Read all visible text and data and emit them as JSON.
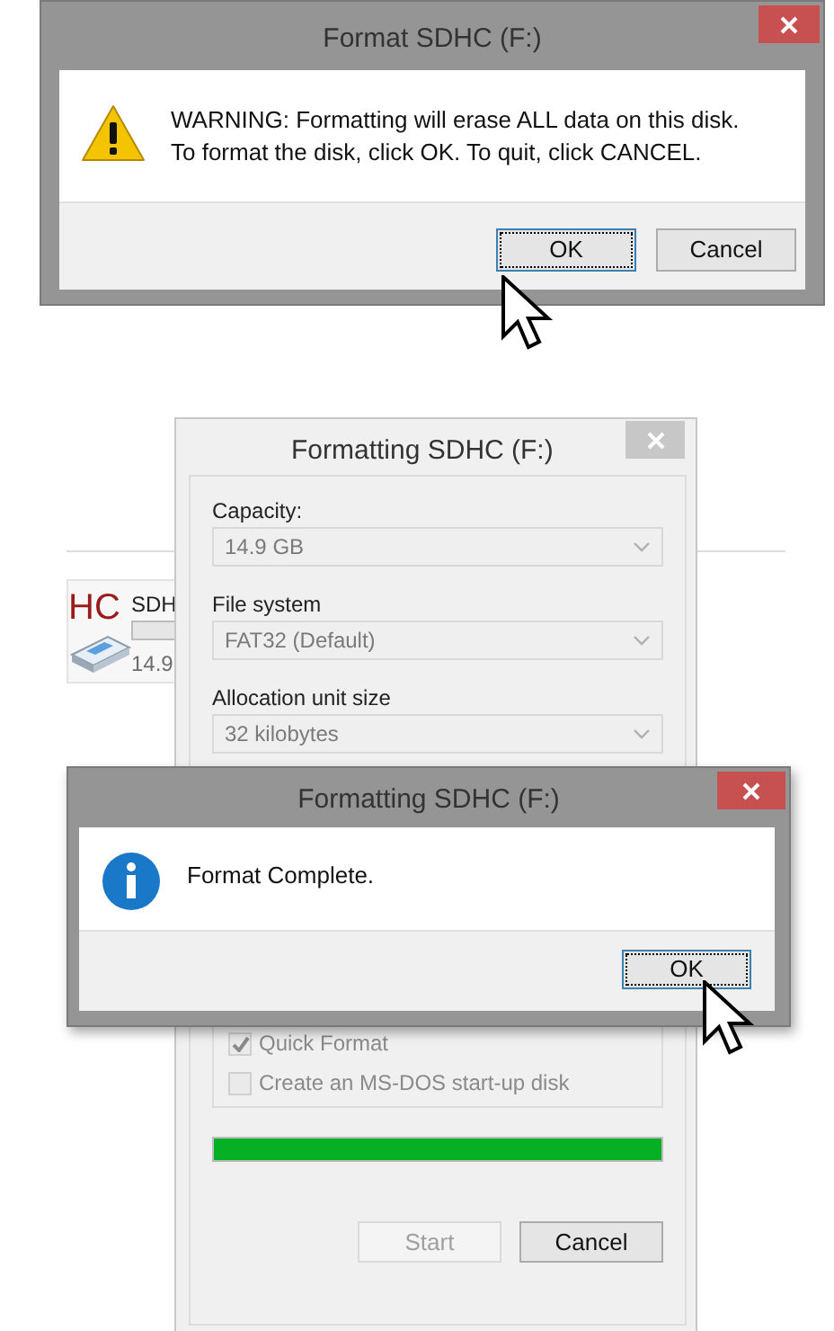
{
  "warning_dialog": {
    "title": "Format SDHC (F:)",
    "active": true,
    "message": [
      "WARNING: Formatting will erase ALL data on this disk.",
      "To format the disk, click OK. To quit, click CANCEL."
    ],
    "buttons": [
      {
        "label": "OK",
        "focused": true
      },
      {
        "label": "Cancel",
        "focused": false
      }
    ]
  },
  "explorer_item": {
    "logo": "HC",
    "name": "SDH",
    "size": "14.9"
  },
  "format_window": {
    "title": "Formatting SDHC (F:)",
    "active": false,
    "fields": [
      {
        "label": "Capacity:",
        "value": "14.9 GB",
        "disabled": true
      },
      {
        "label": "File system",
        "value": "FAT32 (Default)",
        "disabled": true
      },
      {
        "label": "Allocation unit size",
        "value": "32 kilobytes",
        "disabled": true
      }
    ],
    "options": [
      {
        "label": "Quick Format",
        "checked": true,
        "disabled": true
      },
      {
        "label": "Create an MS-DOS start-up disk",
        "checked": false,
        "disabled": true
      }
    ],
    "progress": {
      "level": 1
    },
    "buttons": [
      {
        "label": "Start",
        "disabled": true
      },
      {
        "label": "Cancel",
        "disabled": false
      }
    ]
  },
  "complete_dialog": {
    "title": "Formatting SDHC (F:)",
    "active": true,
    "message": "Format Complete.",
    "buttons": [
      {
        "label": "OK",
        "focused": true
      }
    ]
  }
}
